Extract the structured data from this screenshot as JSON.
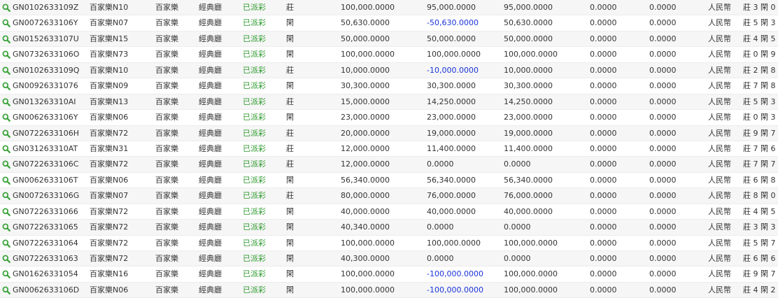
{
  "colors": {
    "status_green": "#2e9a2e",
    "negative_blue": "#1a33d6",
    "search_icon": "#3aa33a",
    "stripe": "#f6f6f6"
  },
  "icons": {
    "row_lookup": "search-icon"
  },
  "rows": [
    {
      "id": "GN0102633109Z",
      "game": "百家樂N10",
      "type": "百家樂",
      "play": "經典廳",
      "status": "已派彩",
      "result": "莊",
      "bet": "100,000.0000",
      "valid": "95,000.0000",
      "valid_negative": false,
      "payout": "95,000.0000",
      "rebate": "0.0000",
      "commission": "0.0000",
      "currency": "人民幣",
      "extra": "莊 3 閑 0"
    },
    {
      "id": "GN0072633106Y",
      "game": "百家樂N07",
      "type": "百家樂",
      "play": "經典廳",
      "status": "已派彩",
      "result": "閑",
      "bet": "50,630.0000",
      "valid": "-50,630.0000",
      "valid_negative": true,
      "payout": "50,630.0000",
      "rebate": "0.0000",
      "commission": "0.0000",
      "currency": "人民幣",
      "extra": "莊 5 閑 3"
    },
    {
      "id": "GN0152633107U",
      "game": "百家樂N15",
      "type": "百家樂",
      "play": "經典廳",
      "status": "已派彩",
      "result": "閑",
      "bet": "50,000.0000",
      "valid": "50,000.0000",
      "valid_negative": false,
      "payout": "50,000.0000",
      "rebate": "0.0000",
      "commission": "0.0000",
      "currency": "人民幣",
      "extra": "莊 4 閑 5"
    },
    {
      "id": "GN0732633106O",
      "game": "百家樂N73",
      "type": "百家樂",
      "play": "經典廳",
      "status": "已派彩",
      "result": "閑",
      "bet": "100,000.0000",
      "valid": "100,000.0000",
      "valid_negative": false,
      "payout": "100,000.0000",
      "rebate": "0.0000",
      "commission": "0.0000",
      "currency": "人民幣",
      "extra": "莊 0 閑 9"
    },
    {
      "id": "GN0102633109Q",
      "game": "百家樂N10",
      "type": "百家樂",
      "play": "經典廳",
      "status": "已派彩",
      "result": "莊",
      "bet": "10,000.0000",
      "valid": "-10,000.0000",
      "valid_negative": true,
      "payout": "10,000.0000",
      "rebate": "0.0000",
      "commission": "0.0000",
      "currency": "人民幣",
      "extra": "莊 2 閑 8"
    },
    {
      "id": "GN00926331076",
      "game": "百家樂N09",
      "type": "百家樂",
      "play": "經典廳",
      "status": "已派彩",
      "result": "閑",
      "bet": "30,300.0000",
      "valid": "30,300.0000",
      "valid_negative": false,
      "payout": "30,300.0000",
      "rebate": "0.0000",
      "commission": "0.0000",
      "currency": "人民幣",
      "extra": "莊 7 閑 8"
    },
    {
      "id": "GN013263310AI",
      "game": "百家樂N13",
      "type": "百家樂",
      "play": "經典廳",
      "status": "已派彩",
      "result": "莊",
      "bet": "15,000.0000",
      "valid": "14,250.0000",
      "valid_negative": false,
      "payout": "14,250.0000",
      "rebate": "0.0000",
      "commission": "0.0000",
      "currency": "人民幣",
      "extra": "莊 5 閑 3"
    },
    {
      "id": "GN0062633106Y",
      "game": "百家樂N06",
      "type": "百家樂",
      "play": "經典廳",
      "status": "已派彩",
      "result": "閑",
      "bet": "23,000.0000",
      "valid": "23,000.0000",
      "valid_negative": false,
      "payout": "23,000.0000",
      "rebate": "0.0000",
      "commission": "0.0000",
      "currency": "人民幣",
      "extra": "莊 0 閑 3"
    },
    {
      "id": "GN0722633106H",
      "game": "百家樂N72",
      "type": "百家樂",
      "play": "經典廳",
      "status": "已派彩",
      "result": "莊",
      "bet": "20,000.0000",
      "valid": "19,000.0000",
      "valid_negative": false,
      "payout": "19,000.0000",
      "rebate": "0.0000",
      "commission": "0.0000",
      "currency": "人民幣",
      "extra": "莊 9 閑 7"
    },
    {
      "id": "GN031263310AT",
      "game": "百家樂N31",
      "type": "百家樂",
      "play": "經典廳",
      "status": "已派彩",
      "result": "莊",
      "bet": "12,000.0000",
      "valid": "11,400.0000",
      "valid_negative": false,
      "payout": "11,400.0000",
      "rebate": "0.0000",
      "commission": "0.0000",
      "currency": "人民幣",
      "extra": "莊 7 閑 6"
    },
    {
      "id": "GN0722633106C",
      "game": "百家樂N72",
      "type": "百家樂",
      "play": "經典廳",
      "status": "已派彩",
      "result": "莊",
      "bet": "12,000.0000",
      "valid": "0.0000",
      "valid_negative": false,
      "payout": "0.0000",
      "rebate": "0.0000",
      "commission": "0.0000",
      "currency": "人民幣",
      "extra": "莊 7 閑 7"
    },
    {
      "id": "GN0062633106T",
      "game": "百家樂N06",
      "type": "百家樂",
      "play": "經典廳",
      "status": "已派彩",
      "result": "閑",
      "bet": "56,340.0000",
      "valid": "56,340.0000",
      "valid_negative": false,
      "payout": "56,340.0000",
      "rebate": "0.0000",
      "commission": "0.0000",
      "currency": "人民幣",
      "extra": "莊 6 閑 8"
    },
    {
      "id": "GN0072633106G",
      "game": "百家樂N07",
      "type": "百家樂",
      "play": "經典廳",
      "status": "已派彩",
      "result": "莊",
      "bet": "80,000.0000",
      "valid": "76,000.0000",
      "valid_negative": false,
      "payout": "76,000.0000",
      "rebate": "0.0000",
      "commission": "0.0000",
      "currency": "人民幣",
      "extra": "莊 8 閑 0"
    },
    {
      "id": "GN07226331066",
      "game": "百家樂N72",
      "type": "百家樂",
      "play": "經典廳",
      "status": "已派彩",
      "result": "閑",
      "bet": "40,000.0000",
      "valid": "40,000.0000",
      "valid_negative": false,
      "payout": "40,000.0000",
      "rebate": "0.0000",
      "commission": "0.0000",
      "currency": "人民幣",
      "extra": "莊 4 閑 5"
    },
    {
      "id": "GN07226331065",
      "game": "百家樂N72",
      "type": "百家樂",
      "play": "經典廳",
      "status": "已派彩",
      "result": "閑",
      "bet": "40,340.0000",
      "valid": "0.0000",
      "valid_negative": false,
      "payout": "0.0000",
      "rebate": "0.0000",
      "commission": "0.0000",
      "currency": "人民幣",
      "extra": "莊 3 閑 3"
    },
    {
      "id": "GN07226331064",
      "game": "百家樂N72",
      "type": "百家樂",
      "play": "經典廳",
      "status": "已派彩",
      "result": "閑",
      "bet": "100,000.0000",
      "valid": "100,000.0000",
      "valid_negative": false,
      "payout": "100,000.0000",
      "rebate": "0.0000",
      "commission": "0.0000",
      "currency": "人民幣",
      "extra": "莊 5 閑 7"
    },
    {
      "id": "GN07226331063",
      "game": "百家樂N72",
      "type": "百家樂",
      "play": "經典廳",
      "status": "已派彩",
      "result": "閑",
      "bet": "40,300.0000",
      "valid": "0.0000",
      "valid_negative": false,
      "payout": "0.0000",
      "rebate": "0.0000",
      "commission": "0.0000",
      "currency": "人民幣",
      "extra": "莊 6 閑 6"
    },
    {
      "id": "GN01626331054",
      "game": "百家樂N16",
      "type": "百家樂",
      "play": "經典廳",
      "status": "已派彩",
      "result": "閑",
      "bet": "100,000.0000",
      "valid": "-100,000.0000",
      "valid_negative": true,
      "payout": "100,000.0000",
      "rebate": "0.0000",
      "commission": "0.0000",
      "currency": "人民幣",
      "extra": "莊 9 閑 7"
    },
    {
      "id": "GN0062633106D",
      "game": "百家樂N06",
      "type": "百家樂",
      "play": "經典廳",
      "status": "已派彩",
      "result": "閑",
      "bet": "100,000.0000",
      "valid": "-100,000.0000",
      "valid_negative": true,
      "payout": "100,000.0000",
      "rebate": "0.0000",
      "commission": "0.0000",
      "currency": "人民幣",
      "extra": "莊 4 閑 2"
    }
  ]
}
